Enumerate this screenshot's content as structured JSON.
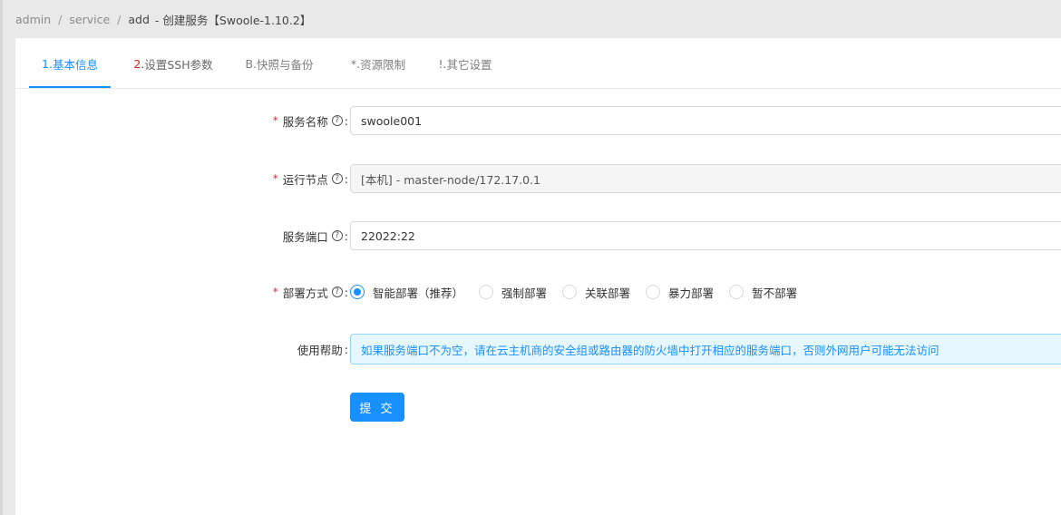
{
  "breadcrumb": {
    "items": [
      "admin",
      "service",
      "add"
    ],
    "separator": "/",
    "title": "-  创建服务【Swoole-1.10.2】"
  },
  "tabs": [
    {
      "num": "1.",
      "label": "基本信息",
      "active": true
    },
    {
      "num": "2.",
      "label": "设置SSH参数",
      "active": false
    },
    {
      "num": "B.",
      "label": "快照与备份",
      "active": false
    },
    {
      "num": "*.",
      "label": "资源限制",
      "active": false
    },
    {
      "num": "!.",
      "label": "其它设置",
      "active": false
    }
  ],
  "form": {
    "service_name": {
      "label": "服务名称",
      "required": true,
      "value": "swoole001"
    },
    "run_node": {
      "label": "运行节点",
      "required": true,
      "value": "[本机] - master-node/172.17.0.1"
    },
    "service_port": {
      "label": "服务端口",
      "required": false,
      "value": "22022:22"
    },
    "deploy_mode": {
      "label": "部署方式",
      "required": true,
      "selected": "智能部署（推荐）",
      "options": [
        "智能部署（推荐）",
        "强制部署",
        "关联部署",
        "暴力部署",
        "暂不部署"
      ]
    },
    "help": {
      "label": "使用帮助",
      "text": "如果服务端口不为空，请在云主机商的安全组或路由器的防火墙中打开相应的服务端口，否则外网用户可能无法访问"
    },
    "submit_label": "提 交"
  },
  "symbols": {
    "required_mark": "*",
    "question_mark": "?",
    "colon": ":"
  },
  "colors": {
    "primary": "#1890ff",
    "required": "#f5222d",
    "tab_number_red": "#e2231a",
    "help_background": "#e6f7ff",
    "help_border": "#91d5ff"
  }
}
